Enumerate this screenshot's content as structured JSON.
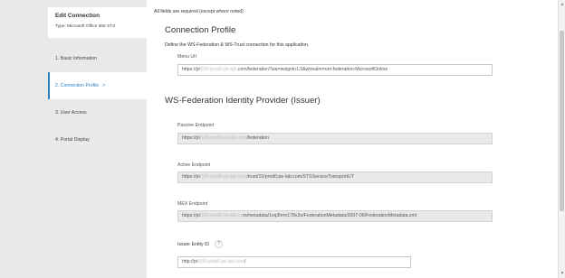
{
  "sidebar": {
    "header_title": "Edit Connection",
    "header_subtitle": "Type: Microsoft Office 365 STS",
    "items": [
      {
        "label": "1. Basic Information"
      },
      {
        "label": "2. Connection Profile",
        "chevron": ">"
      },
      {
        "label": "3. User Access"
      },
      {
        "label": "4. Portal Display"
      }
    ],
    "active_index": 1
  },
  "main": {
    "required_note": "All fields are required (except where noted)",
    "connection_profile": {
      "title": "Connection Profile",
      "description": "Define the WS-Federation & WS-Trust connection for this application.",
      "menu_url": {
        "label": "Menu Url",
        "value_prefix": "https://pi",
        "value_masked": "f100.prod0.pe-lab",
        "value_suffix": ".com/federation?wa=wsignin1.0&wtrealm=urn:federation:MicrosoftOnline"
      }
    },
    "issuer": {
      "title": "WS-Federation Identity Provider (Issuer)",
      "passive_endpoint": {
        "label": "Passive Endpoint",
        "value_prefix": "https://pi",
        "value_masked": "f100.prod0.pe-lab.com",
        "value_suffix": "/federation"
      },
      "active_endpoint": {
        "label": "Active Endpoint",
        "value_prefix": "https://pi",
        "value_masked": "f100.prod0.pe-lab.com",
        "value_suffix": "/trust/10/prod0.pe-lab.com/STSServiceTransportUT"
      },
      "mex_endpoint": {
        "label": "MEX Endpoint",
        "value_prefix": "https://pi",
        "value_masked": "f100.prod0.pe-lab.co",
        "value_suffix": "m/metadata/1vq3hrm178x2o/FederationMetadata/2007-06/FederationMetadata.xml"
      },
      "issuer_entity_id": {
        "label": "Issuer Entity ID",
        "help_icon": "?",
        "value_prefix": "http://pi",
        "value_masked": "f100.prod0.pe-lab.com",
        "value_suffix": "/"
      }
    }
  },
  "scrollbar": {
    "up_arrow": "▲",
    "down_arrow": "▼"
  }
}
